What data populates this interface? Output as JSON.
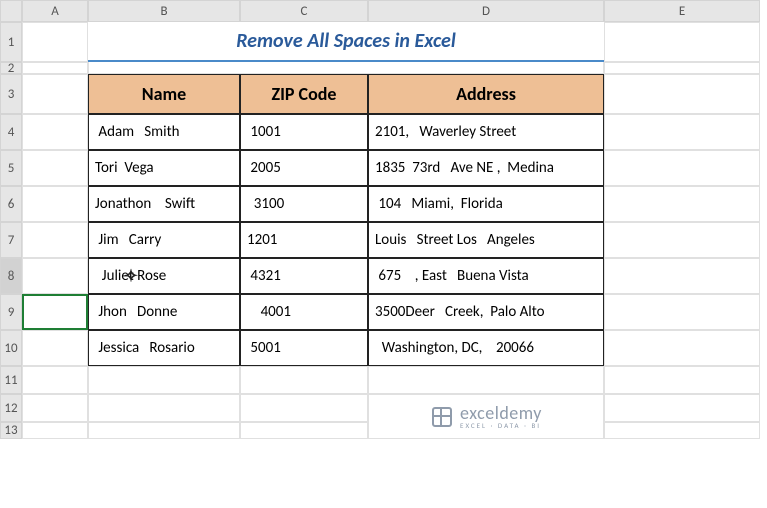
{
  "columns": [
    "",
    "A",
    "B",
    "C",
    "",
    "D",
    "E"
  ],
  "rows": [
    "1",
    "2",
    "3",
    "4",
    "5",
    "6",
    "7",
    "8",
    "9",
    "10",
    "11",
    "12",
    "13"
  ],
  "title": "Remove All Spaces in Excel",
  "headers": {
    "name": "Name",
    "zip": "ZIP Code",
    "address": "Address"
  },
  "data": [
    {
      "name": " Adam   Smith",
      "zip": " 1001",
      "address": "2101,   Waverley Street"
    },
    {
      "name": "Tori  Vega",
      "zip": " 2005",
      "address": "1835  73rd   Ave NE ,  Medina"
    },
    {
      "name": "Jonathon    Swift",
      "zip": "  3100",
      "address": " 104   Miami,  Florida"
    },
    {
      "name": " Jim   Carry",
      "zip": "1201",
      "address": "Louis   Street Los   Angeles"
    },
    {
      "name": "  Juliet Rose",
      "zip": " 4321",
      "address": " 675    , East   Buena Vista"
    },
    {
      "name": " Jhon   Donne",
      "zip": "    4001",
      "address": "3500Deer   Creek,  Palo Alto"
    },
    {
      "name": " Jessica   Rosario",
      "zip": " 5001",
      "address": "  Washington, DC,    20066"
    }
  ],
  "brand": {
    "name": "exceldemy",
    "tag": "EXCEL · DATA · BI"
  },
  "selected_row": 8,
  "chart_data": {
    "type": "table",
    "title": "Remove All Spaces in Excel",
    "columns": [
      "Name",
      "ZIP Code",
      "Address"
    ],
    "rows": [
      [
        " Adam   Smith",
        " 1001",
        "2101,   Waverley Street"
      ],
      [
        "Tori  Vega",
        " 2005",
        "1835  73rd   Ave NE ,  Medina"
      ],
      [
        "Jonathon    Swift",
        "  3100",
        " 104   Miami,  Florida"
      ],
      [
        " Jim   Carry",
        "1201",
        "Louis   Street Los   Angeles"
      ],
      [
        "  Juliet Rose",
        " 4321",
        " 675    , East   Buena Vista"
      ],
      [
        " Jhon   Donne",
        "    4001",
        "3500Deer   Creek,  Palo Alto"
      ],
      [
        " Jessica   Rosario",
        " 5001",
        "  Washington, DC,    20066"
      ]
    ]
  }
}
